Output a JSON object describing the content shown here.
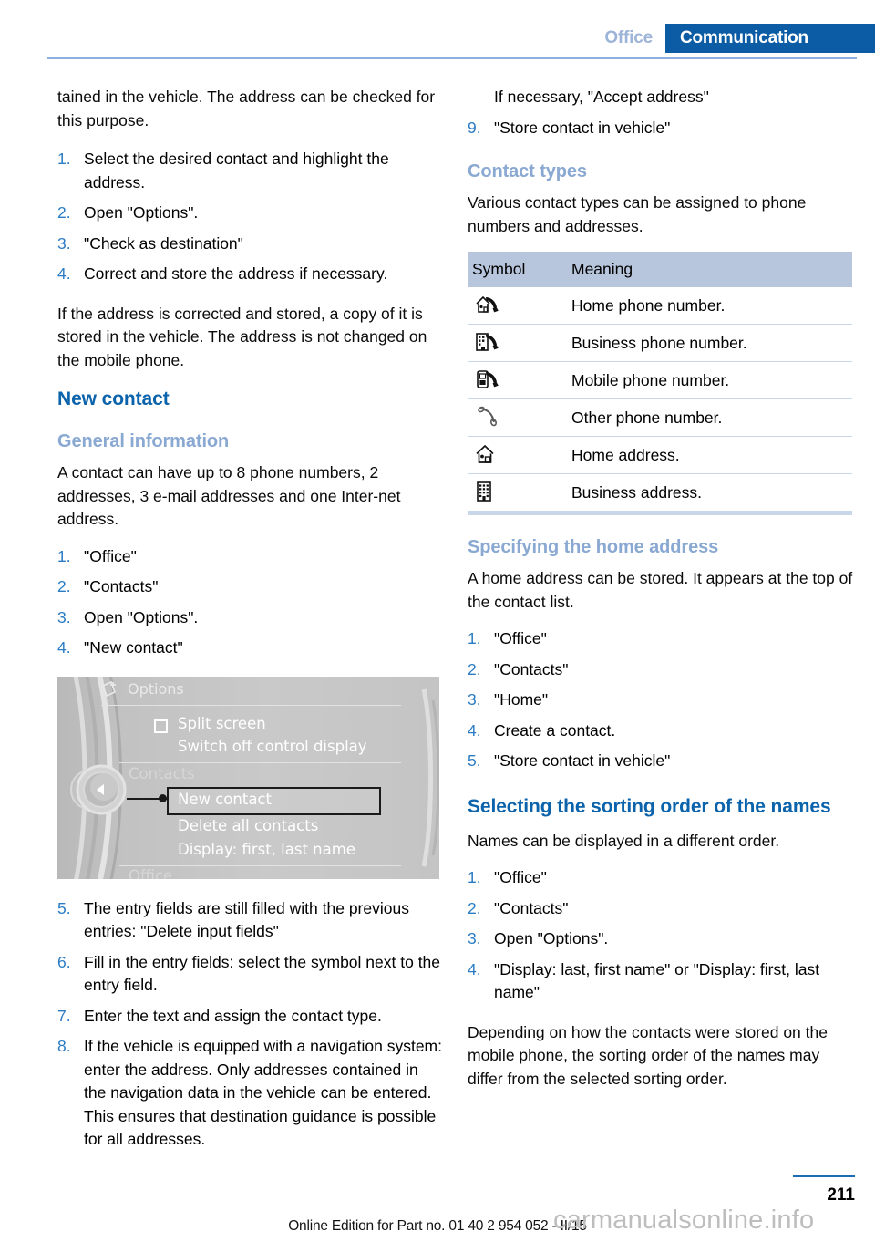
{
  "header": {
    "tab_inactive": "Office",
    "tab_active": "Communication"
  },
  "left_column": {
    "intro_paragraph": "tained in the vehicle. The address can be checked for this purpose.",
    "check_steps": [
      {
        "marker": "1.",
        "text": "Select the desired contact and highlight the address."
      },
      {
        "marker": "2.",
        "text": "Open \"Options\"."
      },
      {
        "marker": "3.",
        "text": "\"Check as destination\""
      },
      {
        "marker": "4.",
        "text": "Correct and store the address if necessary."
      }
    ],
    "after_check_paragraph": "If the address is corrected and stored, a copy of it is stored in the vehicle. The address is not changed on the mobile phone.",
    "new_contact_heading": "New contact",
    "general_information_heading": "General information",
    "general_information_paragraph": "A contact can have up to 8 phone numbers, 2 addresses, 3 e-mail addresses and one Inter-net address.",
    "new_contact_steps_1": [
      {
        "marker": "1.",
        "text": "\"Office\""
      },
      {
        "marker": "2.",
        "text": "\"Contacts\""
      },
      {
        "marker": "3.",
        "text": "Open \"Options\"."
      },
      {
        "marker": "4.",
        "text": "\"New contact\""
      }
    ],
    "idrive_screenshot": {
      "options_label": "Options",
      "options_icon": "options-note-plus-icon",
      "items": [
        {
          "label": "Split screen",
          "checkbox": true
        },
        {
          "label": "Switch off control display",
          "checkbox": false
        }
      ],
      "group_label_contacts": "Contacts",
      "highlighted_item": "New contact",
      "items_after": [
        {
          "label": "Delete all contacts"
        },
        {
          "label": "Display: first, last name"
        }
      ],
      "group_label_office": "Office"
    },
    "new_contact_steps_2": [
      {
        "marker": "5.",
        "text": "The entry fields are still filled with the previous entries: \"Delete input fields\""
      },
      {
        "marker": "6.",
        "text": "Fill in the entry fields: select the symbol next to the entry field."
      },
      {
        "marker": "7.",
        "text": "Enter the text and assign the contact type."
      },
      {
        "marker": "8.",
        "text": "If the vehicle is equipped with a navigation system: enter the address. Only addresses contained in the navigation data in the vehicle can be entered. This ensures that destination guidance is possible for all addresses."
      }
    ]
  },
  "right_column": {
    "continued_steps": [
      {
        "marker": "",
        "text": "If necessary, \"Accept address\""
      },
      {
        "marker": "9.",
        "text": "\"Store contact in vehicle\""
      }
    ],
    "contact_types_heading": "Contact types",
    "contact_types_paragraph": "Various contact types can be assigned to phone numbers and addresses.",
    "symbol_table": {
      "columns": [
        "Symbol",
        "Meaning"
      ],
      "rows": [
        {
          "icon": "home-phone-icon",
          "meaning": "Home phone number."
        },
        {
          "icon": "business-phone-icon",
          "meaning": "Business phone number."
        },
        {
          "icon": "mobile-phone-icon",
          "meaning": "Mobile phone number."
        },
        {
          "icon": "other-phone-icon",
          "meaning": "Other phone number."
        },
        {
          "icon": "home-address-icon",
          "meaning": "Home address."
        },
        {
          "icon": "business-address-icon",
          "meaning": "Business address."
        }
      ]
    },
    "home_address_heading": "Specifying the home address",
    "home_address_paragraph": "A home address can be stored. It appears at the top of the contact list.",
    "home_address_steps": [
      {
        "marker": "1.",
        "text": "\"Office\""
      },
      {
        "marker": "2.",
        "text": "\"Contacts\""
      },
      {
        "marker": "3.",
        "text": "\"Home\""
      },
      {
        "marker": "4.",
        "text": "Create a contact."
      },
      {
        "marker": "5.",
        "text": "\"Store contact in vehicle\""
      }
    ],
    "sorting_heading": "Selecting the sorting order of the names",
    "sorting_paragraph": "Names can be displayed in a different order.",
    "sorting_steps": [
      {
        "marker": "1.",
        "text": "\"Office\""
      },
      {
        "marker": "2.",
        "text": "\"Contacts\""
      },
      {
        "marker": "3.",
        "text": "Open \"Options\"."
      },
      {
        "marker": "4.",
        "text": "\"Display: last, first name\" or \"Display: first, last name\""
      }
    ],
    "sorting_closing_paragraph": "Depending on how the contacts were stored on the mobile phone, the sorting order of the names may differ from the selected sorting order."
  },
  "footer": {
    "page_number": "211",
    "edition_note": "Online Edition for Part no. 01 40 2 954 052 - II/15",
    "watermark": "carmanualsonline.info"
  },
  "colors": {
    "accent_blue": "#0b5ca5",
    "heading_blue": "#0b63ab",
    "subheading_blue": "#8aa9d2",
    "marker_blue": "#2b7cc4",
    "rule_blue": "#8cb0de",
    "table_header_bg": "#b8c6dd"
  }
}
